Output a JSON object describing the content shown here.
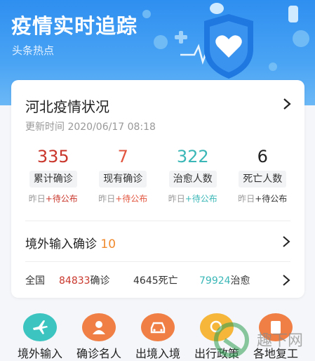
{
  "hero": {
    "title": "疫情实时追踪",
    "subtitle": "头条热点",
    "icon": "shield-heart-icon"
  },
  "card": {
    "title": "河北疫情状况",
    "update_time": "更新时间 2020/06/17 08:18",
    "stats": [
      {
        "value": "335",
        "label": "累计确诊",
        "delta_prefix": "昨日",
        "delta_value": "+待公布",
        "color": "#c9372c",
        "delta_color": "#c9372c"
      },
      {
        "value": "7",
        "label": "现有确诊",
        "delta_prefix": "昨日",
        "delta_value": "+待公布",
        "color": "#e2553f",
        "delta_color": "#e2553f"
      },
      {
        "value": "322",
        "label": "治愈人数",
        "delta_prefix": "昨日",
        "delta_value": "+待公布",
        "color": "#3bb7b7",
        "delta_color": "#3bb7b7"
      },
      {
        "value": "6",
        "label": "死亡人数",
        "delta_prefix": "昨日",
        "delta_value": "+待公布",
        "color": "#222222",
        "delta_color": "#333333"
      }
    ],
    "imported": {
      "label": "境外输入确诊",
      "count": "10"
    },
    "national": {
      "label": "全国",
      "confirmed_value": "84833",
      "confirmed_unit": "确诊",
      "deaths_value": "4645",
      "deaths_unit": "死亡",
      "cured_value": "79924",
      "cured_unit": "治愈"
    }
  },
  "shortcuts": [
    {
      "label": "境外输入",
      "icon": "airplane-icon",
      "color": "#3cc4c0"
    },
    {
      "label": "确诊名人",
      "icon": "person-icon",
      "color": "#f07f45"
    },
    {
      "label": "出境入境",
      "icon": "car-icon",
      "color": "#f07f45"
    },
    {
      "label": "出行政策",
      "icon": "search-icon",
      "color": "#f5b63a"
    },
    {
      "label": "各地复工",
      "icon": "document-icon",
      "color": "#f07f45"
    }
  ],
  "watermark": {
    "text": "趣下网"
  }
}
